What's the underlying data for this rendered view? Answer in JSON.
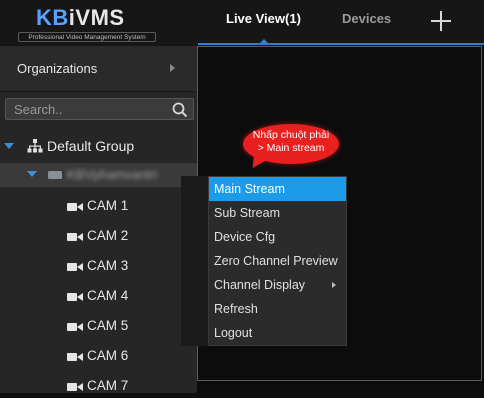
{
  "header": {
    "logo_main": "KBiVMS",
    "logo_sub": "Professional Video Management System",
    "tabs": [
      {
        "label": "Live View(1)",
        "active": true
      },
      {
        "label": "Devices",
        "active": false
      }
    ],
    "add_icon": "plus-icon"
  },
  "sidebar": {
    "organizations_label": "Organizations",
    "search_placeholder": "Search..",
    "group_label": "Default Group",
    "device_label": "KBVphamvantri",
    "cameras": [
      "CAM 1",
      "CAM 2",
      "CAM 3",
      "CAM 4",
      "CAM 5",
      "CAM 6",
      "CAM 7"
    ]
  },
  "context_menu": {
    "items": [
      {
        "label": "Main Stream",
        "highlighted": true,
        "submenu": false
      },
      {
        "label": "Sub Stream",
        "highlighted": false,
        "submenu": false
      },
      {
        "label": "Device Cfg",
        "highlighted": false,
        "submenu": false
      },
      {
        "label": "Zero Channel Preview",
        "highlighted": false,
        "submenu": false
      },
      {
        "label": "Channel Display",
        "highlighted": false,
        "submenu": true
      },
      {
        "label": "Refresh",
        "highlighted": false,
        "submenu": false
      },
      {
        "label": "Logout",
        "highlighted": false,
        "submenu": false
      }
    ]
  },
  "callout": {
    "line1": "Nhấp chuột phải",
    "line2": "> Main stream",
    "color": "#e8201f"
  },
  "colors": {
    "accent": "#1e9be8",
    "tab_underline": "#2f7fd0",
    "tree_arrow": "#3b8fd8"
  }
}
